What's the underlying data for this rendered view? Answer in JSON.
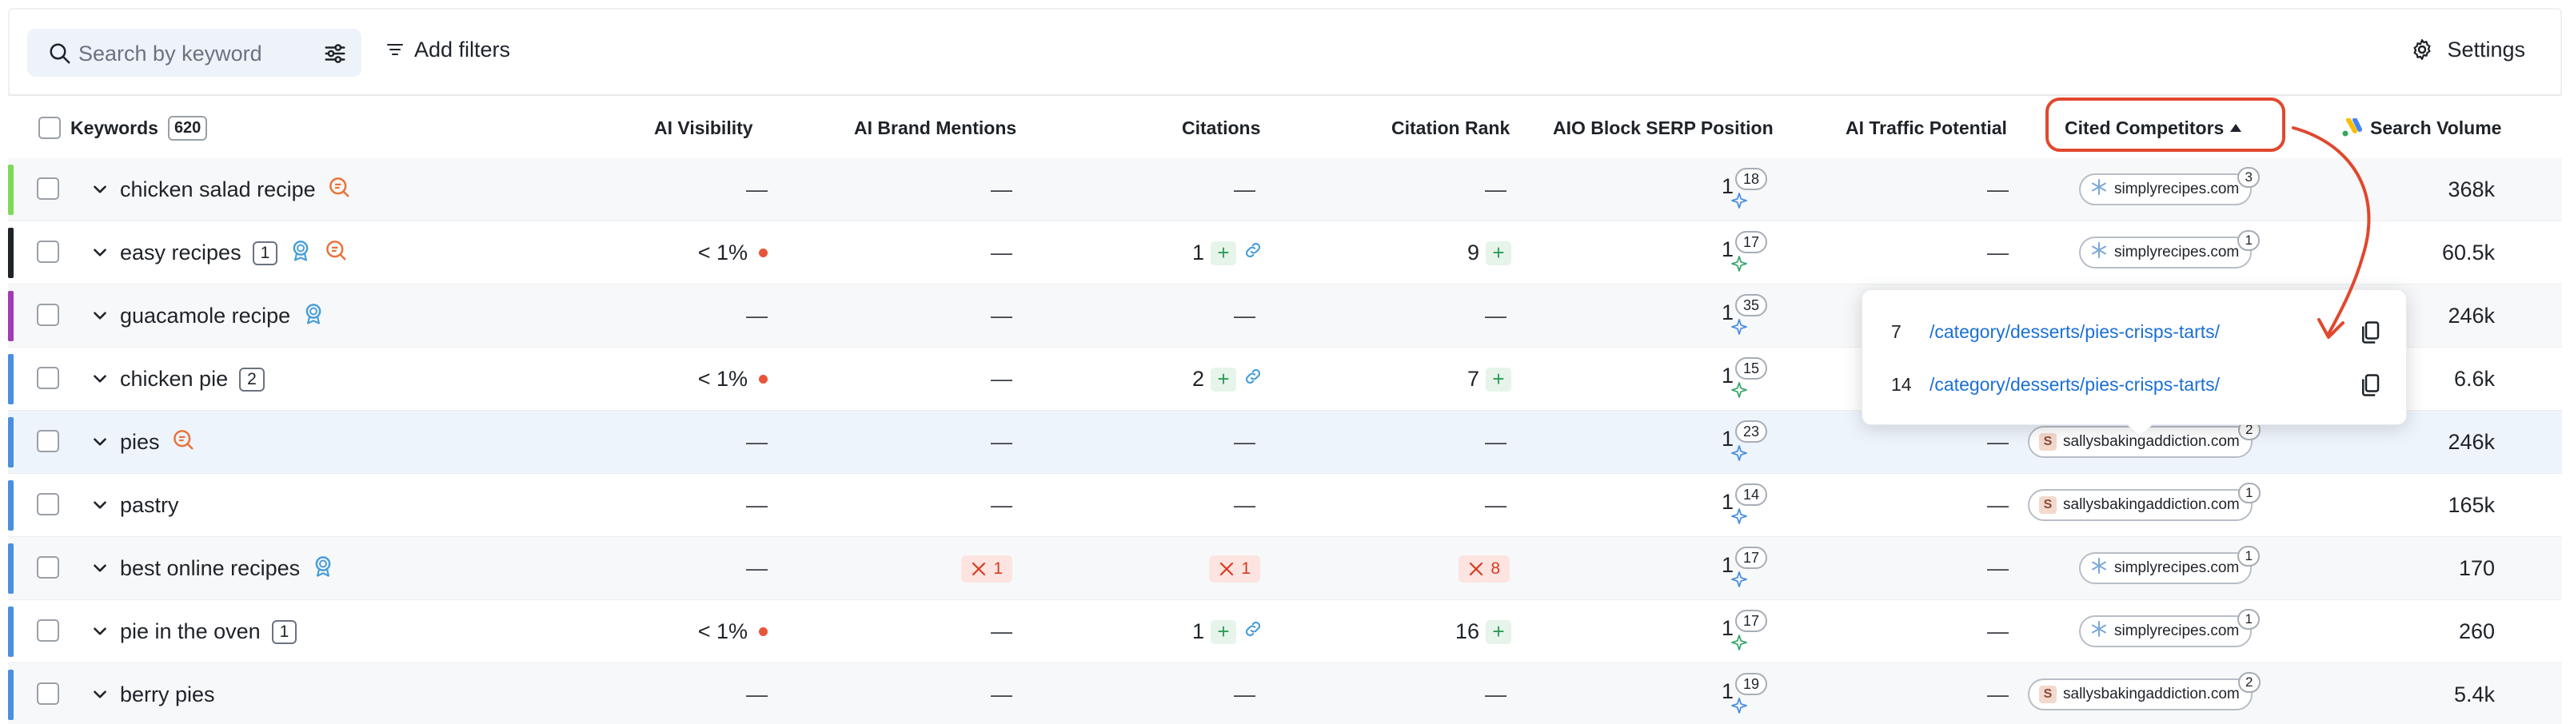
{
  "toolbar": {
    "search_placeholder": "Search by keyword",
    "add_filters_label": "Add filters",
    "settings_label": "Settings"
  },
  "header": {
    "keywords_label": "Keywords",
    "keywords_count": "620",
    "columns": {
      "ai_visibility": "AI Visibility",
      "ai_brand_mentions": "AI Brand Mentions",
      "citations": "Citations",
      "citation_rank": "Citation Rank",
      "aio_block_serp_position": "AIO Block SERP Position",
      "ai_traffic_potential": "AI Traffic Potential",
      "cited_competitors": "Cited Competitors",
      "search_volume": "Search Volume"
    }
  },
  "rows": [
    {
      "keyword": "chicken salad recipe",
      "badge": "",
      "icons": [
        "search-comment-icon"
      ],
      "bar_color": "#7ed957",
      "ai_visibility": "—",
      "mentions": "—",
      "citations": "—",
      "citation_rank": "—",
      "aio_pos": "1",
      "aio_count": "18",
      "traffic": "—",
      "competitor": "simplyrecipes.com",
      "competitor_count": "3",
      "volume": "368k"
    },
    {
      "keyword": "easy recipes",
      "badge": "1",
      "icons": [
        "award-icon",
        "search-comment-icon"
      ],
      "bar_color": "#1f2329",
      "ai_visibility": "< 1%",
      "mentions": "—",
      "citations": "1",
      "citation_rank": "9",
      "aio_pos": "1",
      "aio_count": "17",
      "traffic": "—",
      "competitor": "simplyrecipes.com",
      "competitor_count": "1",
      "volume": "60.5k"
    },
    {
      "keyword": "guacamole recipe",
      "badge": "",
      "icons": [
        "award-icon"
      ],
      "bar_color": "#a23bb5",
      "ai_visibility": "—",
      "mentions": "—",
      "citations": "—",
      "citation_rank": "—",
      "aio_pos": "1",
      "aio_count": "35",
      "traffic": "",
      "competitor": "",
      "competitor_count": "",
      "volume": "246k"
    },
    {
      "keyword": "chicken pie",
      "badge": "2",
      "icons": [],
      "bar_color": "#4a8fe0",
      "ai_visibility": "< 1%",
      "mentions": "—",
      "citations": "2",
      "citation_rank": "7",
      "aio_pos": "1",
      "aio_count": "15",
      "traffic": "",
      "competitor": "",
      "competitor_count": "",
      "volume": "6.6k"
    },
    {
      "keyword": "pies",
      "badge": "",
      "icons": [
        "search-comment-icon"
      ],
      "bar_color": "#4a8fe0",
      "ai_visibility": "—",
      "mentions": "—",
      "citations": "—",
      "citation_rank": "—",
      "aio_pos": "1",
      "aio_count": "23",
      "traffic": "—",
      "competitor": "sallysbakingaddiction.com",
      "competitor_count": "2",
      "volume": "246k"
    },
    {
      "keyword": "pastry",
      "badge": "",
      "icons": [],
      "bar_color": "#4a8fe0",
      "ai_visibility": "—",
      "mentions": "—",
      "citations": "—",
      "citation_rank": "—",
      "aio_pos": "1",
      "aio_count": "14",
      "traffic": "—",
      "competitor": "sallysbakingaddiction.com",
      "competitor_count": "1",
      "volume": "165k"
    },
    {
      "keyword": "best online recipes",
      "badge": "",
      "icons": [
        "award-icon"
      ],
      "bar_color": "#4a8fe0",
      "ai_visibility": "—",
      "mentions": "1",
      "citations": "1",
      "citation_rank": "8",
      "aio_pos": "1",
      "aio_count": "17",
      "traffic": "—",
      "competitor": "simplyrecipes.com",
      "competitor_count": "1",
      "volume": "170"
    },
    {
      "keyword": "pie in the oven",
      "badge": "1",
      "icons": [],
      "bar_color": "#4a8fe0",
      "ai_visibility": "< 1%",
      "mentions": "—",
      "citations": "1",
      "citation_rank": "16",
      "aio_pos": "1",
      "aio_count": "17",
      "traffic": "—",
      "competitor": "simplyrecipes.com",
      "competitor_count": "1",
      "volume": "260"
    },
    {
      "keyword": "berry pies",
      "badge": "",
      "icons": [],
      "bar_color": "#4a8fe0",
      "ai_visibility": "—",
      "mentions": "—",
      "citations": "—",
      "citation_rank": "—",
      "aio_pos": "1",
      "aio_count": "19",
      "traffic": "—",
      "competitor": "sallysbakingaddiction.com",
      "competitor_count": "2",
      "volume": "5.4k"
    }
  ],
  "popup": {
    "items": [
      {
        "rank": "7",
        "url": "/category/desserts/pies-crisps-tarts/"
      },
      {
        "rank": "14",
        "url": "/category/desserts/pies-crisps-tarts/"
      }
    ]
  },
  "colors": {
    "accent_red": "#e0482e",
    "link_blue": "#1a6fd6",
    "plus_green": "#2e9b57",
    "error_red": "#d93a20"
  }
}
